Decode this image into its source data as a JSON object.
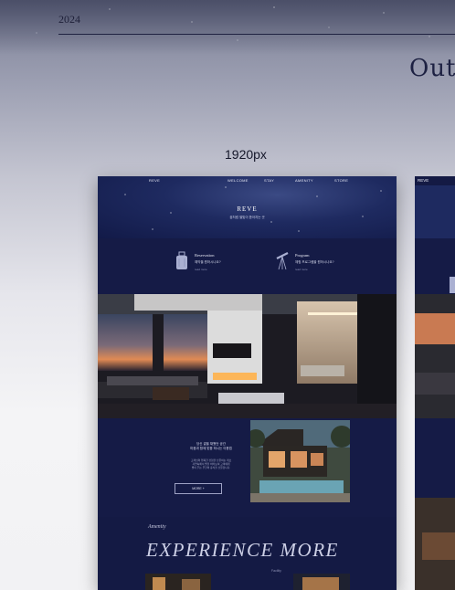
{
  "header": {
    "year": "2024",
    "section_title": "Out"
  },
  "breakpoint_label": "1920px",
  "mockup": {
    "nav": {
      "logo": "REVE",
      "items": [
        "WELCOME",
        "STAY",
        "AMENITY",
        "STORE"
      ]
    },
    "hero": {
      "title": "REVE",
      "subtitle": "꿈처럼 별빛이 쏟아지는 곳"
    },
    "cards": [
      {
        "icon": "luggage-icon",
        "title": "Reservation",
        "desc": "예약을 원하시나요?",
        "link": "read more"
      },
      {
        "icon": "telescope-icon",
        "title": "Program",
        "desc": "체험 프로그램을 원하시나요?",
        "link": "read more"
      }
    ],
    "story": {
      "heading": "당신 곁을 채웠던 공간\n마음과 함께 맞춤 하시는 이용법",
      "body": "고객님의 행복한 경험을 선물하는 레브\n자연속에서 별을 바라보며 고객에게\n별이 주는 무한의 휴식을 선물합니다.",
      "button": "MORE +"
    },
    "amenity": {
      "kicker": "Amenity",
      "title": "EXPERIENCE MORE",
      "facility_label": "Facility"
    }
  },
  "second_mockup": {
    "logo": "REVE"
  }
}
